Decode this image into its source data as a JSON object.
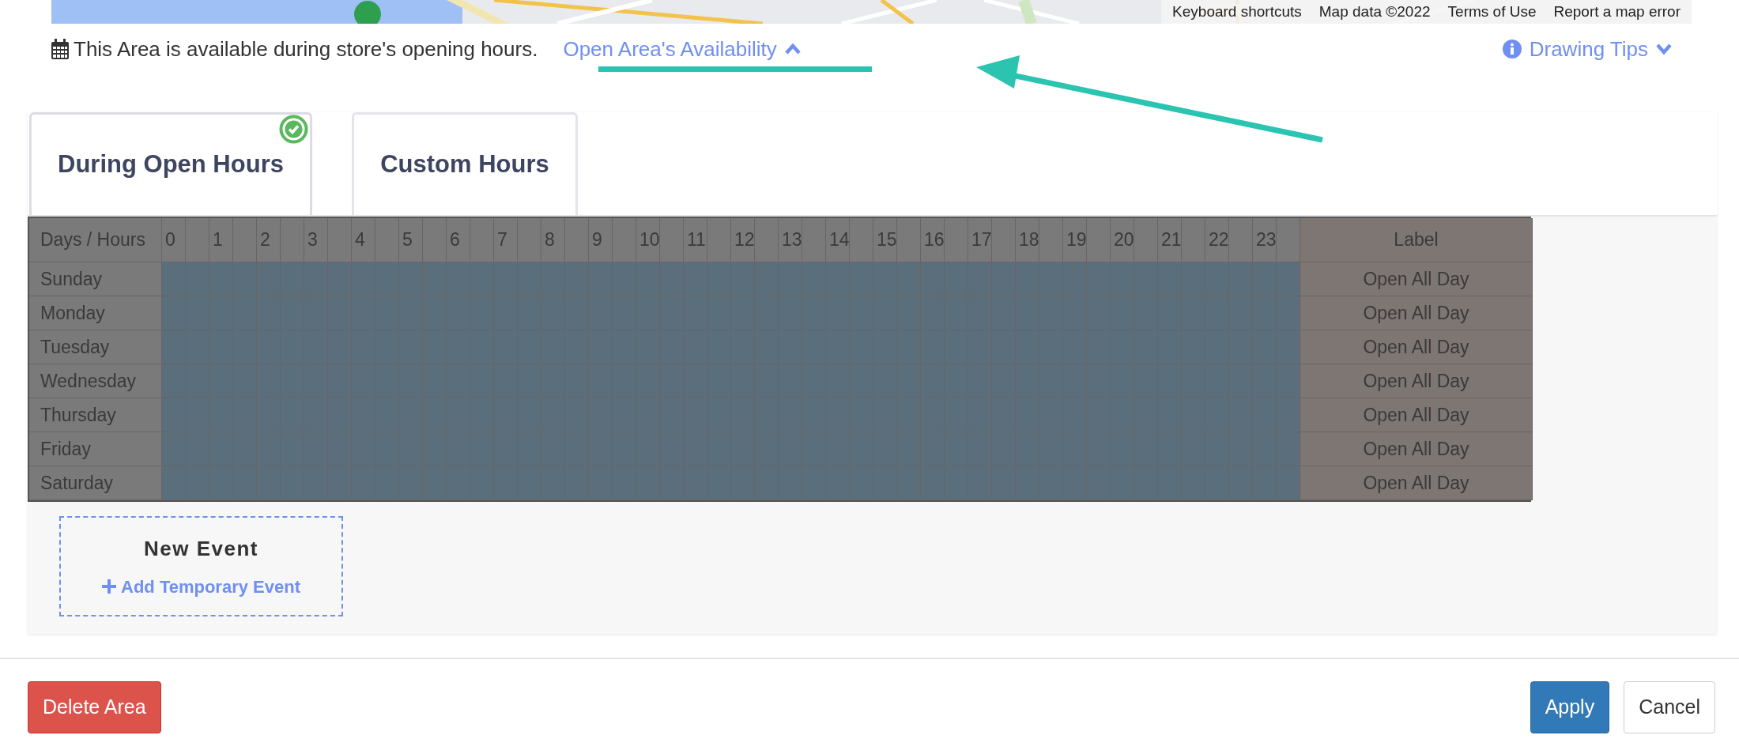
{
  "map": {
    "kind": "picture",
    "attribution": [
      "Keyboard shortcuts",
      "Map data ©2022",
      "Terms of Use",
      "Report a map error"
    ]
  },
  "availability": {
    "text": "This Area is available during store's opening hours.",
    "link": "Open Area's Availability",
    "expanded": true
  },
  "drawing_tips": {
    "label": "Drawing Tips",
    "expanded": false
  },
  "tabs": [
    {
      "label": "During Open Hours",
      "selected": true
    },
    {
      "label": "Custom Hours",
      "selected": false
    }
  ],
  "schedule": {
    "corner": "Days / Hours",
    "hours": [
      "0",
      "1",
      "2",
      "3",
      "4",
      "5",
      "6",
      "7",
      "8",
      "9",
      "10",
      "11",
      "12",
      "13",
      "14",
      "15",
      "16",
      "17",
      "18",
      "19",
      "20",
      "21",
      "22",
      "23"
    ],
    "label_header": "Label",
    "rows": [
      {
        "day": "Sunday",
        "open": true,
        "label": "Open All Day"
      },
      {
        "day": "Monday",
        "open": true,
        "label": "Open All Day"
      },
      {
        "day": "Tuesday",
        "open": true,
        "label": "Open All Day"
      },
      {
        "day": "Wednesday",
        "open": true,
        "label": "Open All Day"
      },
      {
        "day": "Thursday",
        "open": true,
        "label": "Open All Day"
      },
      {
        "day": "Friday",
        "open": true,
        "label": "Open All Day"
      },
      {
        "day": "Saturday",
        "open": true,
        "label": "Open All Day"
      }
    ]
  },
  "new_event": {
    "title": "New Event",
    "action": "Add Temporary Event"
  },
  "buttons": [
    {
      "label": "Delete Area",
      "kind": "danger"
    },
    {
      "label": "Apply",
      "kind": "primary"
    },
    {
      "label": "Cancel",
      "kind": "secondary"
    }
  ]
}
